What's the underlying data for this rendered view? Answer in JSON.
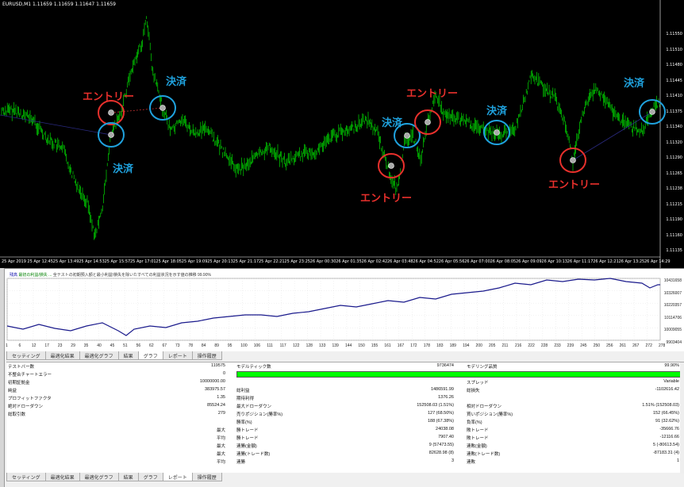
{
  "chart": {
    "title": "EURUSD,M1  1.11659 1.11659 1.11647 1.11659",
    "y_ticks": [
      "1.11550",
      "1.11445",
      "1.11340",
      "1.11290",
      "1.11238",
      "1.11190",
      "1.11135"
    ],
    "y_ticks_extra": [
      "1.11510",
      "1.11480",
      "1.11410",
      "1.11375",
      "1.11320",
      "1.11265",
      "1.11215",
      "1.11160"
    ],
    "x_ticks": [
      "25 Apr 2019",
      "25 Apr 12:45",
      "25 Apr 13:49",
      "25 Apr 14:53",
      "25 Apr 15:57",
      "25 Apr 17:01",
      "25 Apr 18:05",
      "25 Apr 19:09",
      "25 Apr 20:13",
      "25 Apr 21:17",
      "25 Apr 22:21",
      "25 Apr 23:25",
      "26 Apr 00:30",
      "26 Apr 01:35",
      "26 Apr 02:42",
      "26 Apr 03:48",
      "26 Apr 04:52",
      "26 Apr 05:56",
      "26 Apr 07:00",
      "26 Apr 08:05",
      "26 Apr 09:09",
      "26 Apr 10:13",
      "26 Apr 11:17",
      "26 Apr 12:21",
      "26 Apr 13:25",
      "26 Apr 14:29"
    ],
    "annotations": {
      "entry": "エントリー",
      "exit": "決済"
    },
    "colors": {
      "candles": "#00ff00",
      "entry": "#e8302c",
      "exit": "#1fa2de"
    }
  },
  "graph": {
    "legend_1": "残高",
    "legend_2": "最初の利益/損失 ...",
    "legend_text": "全テストの初期預入額と最小利益/損失を除いたすべての利益状況を示す値の推移",
    "legend_end": "99.90%",
    "y_ticks": [
      "10431658",
      "10326007",
      "10220357",
      "10114706",
      "10009055",
      "9903404"
    ],
    "x_ticks": [
      "1",
      "6",
      "12",
      "17",
      "23",
      "29",
      "35",
      "40",
      "45",
      "51",
      "56",
      "62",
      "67",
      "73",
      "78",
      "84",
      "89",
      "95",
      "100",
      "106",
      "111",
      "117",
      "122",
      "128",
      "133",
      "139",
      "144",
      "150",
      "155",
      "161",
      "167",
      "172",
      "178",
      "183",
      "189",
      "194",
      "200",
      "205",
      "211",
      "216",
      "222",
      "228",
      "233",
      "239",
      "245",
      "250",
      "256",
      "261",
      "267",
      "272",
      "278"
    ],
    "line_color": "#1a1a8c"
  },
  "tabs": [
    "セッティング",
    "最適化結果",
    "最適化グラフ",
    "結果",
    "グラフ",
    "レポート",
    "操作履歴"
  ],
  "tabs_active_top": "グラフ",
  "tabs_active_bottom": "レポート",
  "side_label": "テスター",
  "report": {
    "r1": {
      "c1": "テストバー数",
      "c2": "119575",
      "c3": "モデルティック数",
      "c4": "9736474",
      "c5": "モデリング品質",
      "c6": "99.90%"
    },
    "r2": {
      "c1": "不整合チャートエラー",
      "c2": "0"
    },
    "r3": {
      "c1": "初期証拠金",
      "c2": "10000000.00",
      "c5": "スプレッド",
      "c6": "Variable"
    },
    "r4": {
      "c1": "純益",
      "c2": "383975.57",
      "c3": "総利益",
      "c4": "1486591.99",
      "c5": "総損失",
      "c6": "-1102616.42"
    },
    "r5": {
      "c1": "プロフィットファクタ",
      "c2": "1.35",
      "c3": "期待利得",
      "c4": "1376.26"
    },
    "r6": {
      "c1": "絶対ドローダウン",
      "c2": "85524.24",
      "c3": "最大ドローダウン",
      "c4": "152508.03 (1.51%)",
      "c5": "相対ドローダウン",
      "c6": "1.51% (152508.03)"
    },
    "r7": {
      "c1": "総取引数",
      "c2": "279",
      "c3": "売りポジション(勝率%)",
      "c4": "127 (68.50%)",
      "c5": "買いポジション(勝率%)",
      "c6": "152 (66.45%)"
    },
    "r8": {
      "c3": "勝率(%)",
      "c4": "188 (67.38%)",
      "c5": "負率(%)",
      "c6": "91 (32.62%)"
    },
    "r9": {
      "clab": "最大",
      "c3": "勝トレード",
      "c4": "24038.08",
      "c5": "敗トレード",
      "c6": "-35666.76"
    },
    "r10": {
      "clab": "平均",
      "c3": "勝トレード",
      "c4": "7907.40",
      "c5": "敗トレード",
      "c6": "-12116.66"
    },
    "r11": {
      "clab": "最大",
      "c3": "連勝(金額)",
      "c4": "9 (57473.55)",
      "c5": "連敗(金額)",
      "c6": "5 (-80613.54)"
    },
    "r12": {
      "clab": "最大",
      "c3": "連勝(トレード数)",
      "c4": "82628.98 (8)",
      "c5": "連敗(トレード数)",
      "c6": "-87183.31 (4)"
    },
    "r13": {
      "clab": "平均",
      "c3": "連勝",
      "c4": "3",
      "c5": "連敗",
      "c6": "1"
    }
  }
}
